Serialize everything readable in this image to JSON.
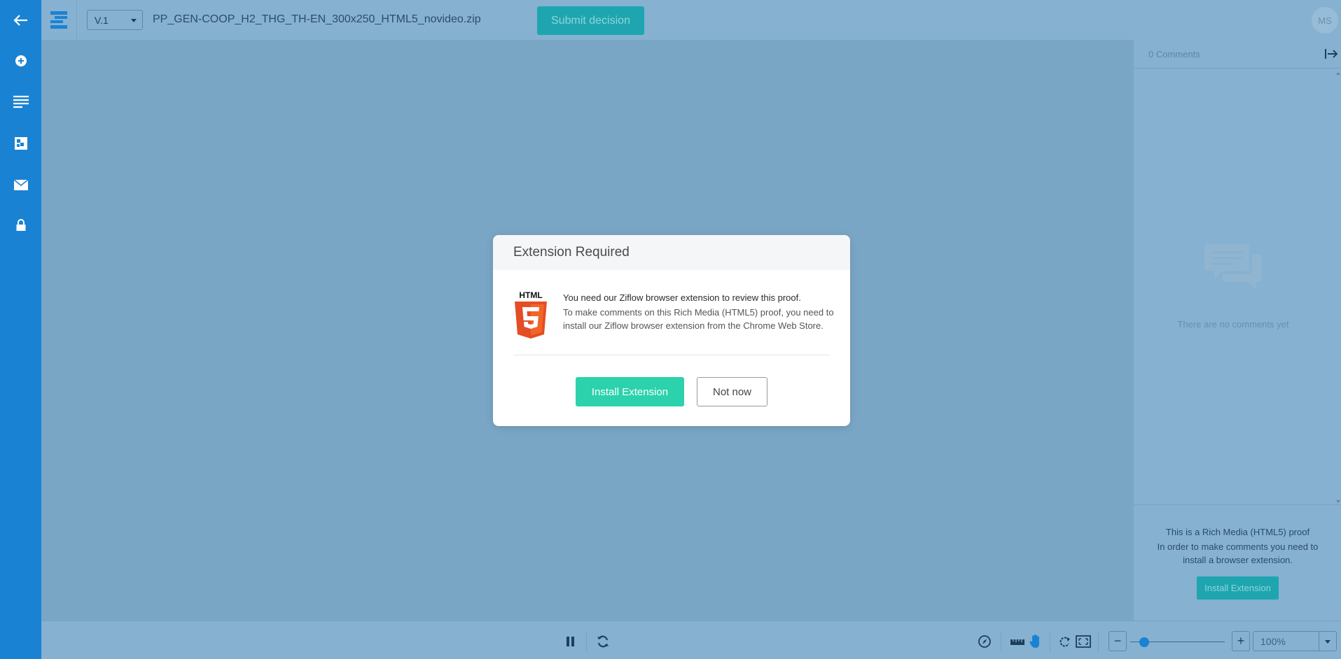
{
  "topbar": {
    "version": "V.1",
    "file_name": "PP_GEN-COOP_H2_THG_TH-EN_300x250_HTML5_novideo.zip",
    "submit_label": "Submit decision",
    "avatar_initials": "MS"
  },
  "leftnav": {
    "icons": [
      "back-arrow-icon",
      "add-circle-icon",
      "list-lines-icon",
      "compare-icon",
      "mail-icon",
      "lock-icon"
    ]
  },
  "comments_panel": {
    "count_label": "0 Comments",
    "empty_text": "There are no comments yet",
    "footer_title": "This is a Rich Media (HTML5) proof",
    "footer_message": "In order to make comments you need to install a browser extension.",
    "install_label": "Install Extension"
  },
  "modal": {
    "title": "Extension Required",
    "logo_text": "HTML",
    "lead": "You need our Ziflow browser extension to review this proof.",
    "text": "To make comments on this Rich Media (HTML5) proof, you need to install our Ziflow browser extension from the Chrome Web Store.",
    "install_label": "Install Extension",
    "not_now_label": "Not now"
  },
  "bottombar": {
    "zoom_minus": "−",
    "zoom_plus": "+",
    "zoom_value": "100%",
    "zoom_level": 0.15
  },
  "colors": {
    "nav_blue": "#1a82d3",
    "accent_teal": "#1ea5b0",
    "install_green": "#2bd2ab",
    "overlay": "#7aa6c6"
  }
}
